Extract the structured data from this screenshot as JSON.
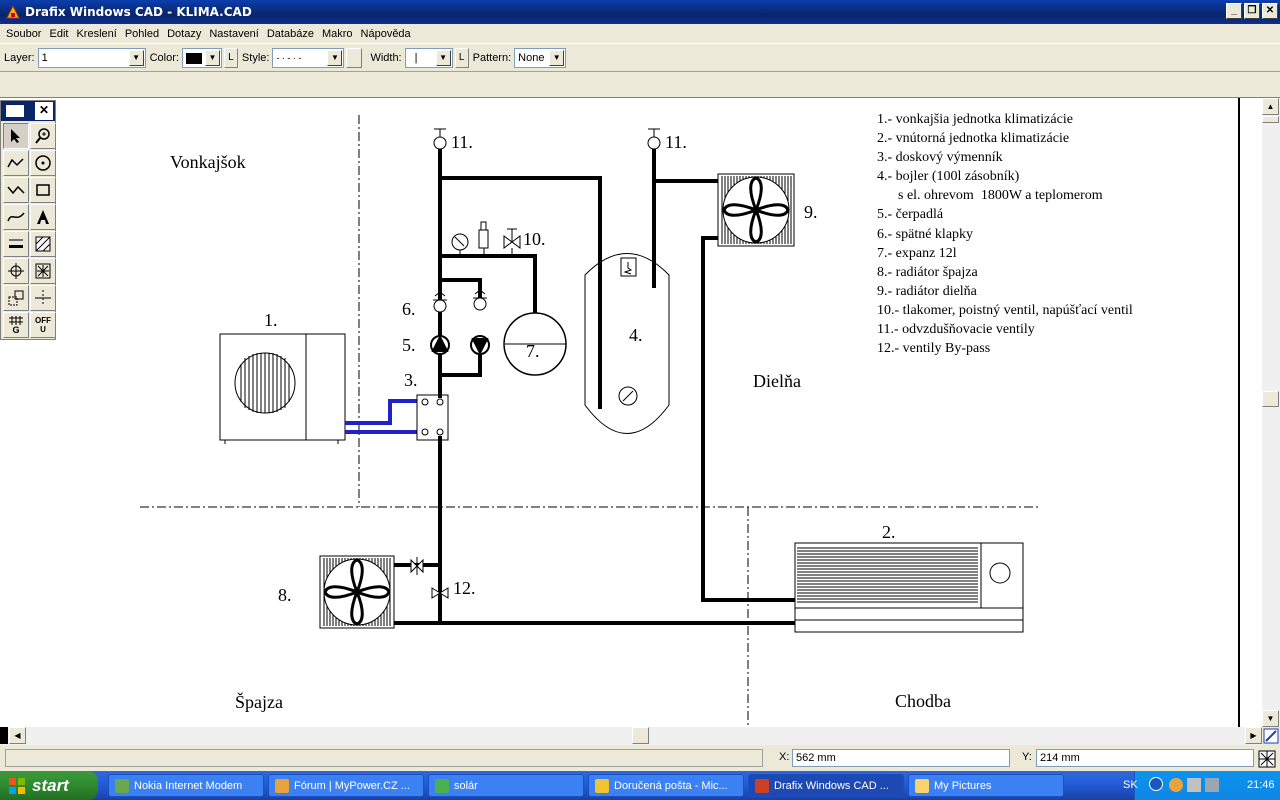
{
  "window": {
    "title": "Drafix Windows CAD - KLIMA.CAD",
    "min": "_",
    "max": "❐",
    "close": "✕"
  },
  "menu": [
    "Soubor",
    "Edit",
    "Kreslení",
    "Pohled",
    "Dotazy",
    "Nastavení",
    "Databáze",
    "Makro",
    "Nápověda"
  ],
  "toolbar": {
    "layer_label": "Layer:",
    "layer_value": "1",
    "color_label": "Color:",
    "color_value": "#000000",
    "style_label": "Style:",
    "style_value": "- · - · -",
    "width_label": "Width:",
    "width_value": "|",
    "pattern_label": "Pattern:",
    "pattern_value": "None",
    "lock_label": "L"
  },
  "palette": {
    "grid_label": "G",
    "off_label": "OFF",
    "off_sub": "U"
  },
  "drawing": {
    "rooms": {
      "outside": "Vonkajšok",
      "workshop": "Dielňa",
      "pantry": "Špajza",
      "corridor": "Chodba"
    },
    "labels": {
      "l1": "1.",
      "l2": "2.",
      "l3": "3.",
      "l4": "4.",
      "l5": "5.",
      "l6": "6.",
      "l7": "7.",
      "l8": "8.",
      "l9": "9.",
      "l10": "10.",
      "l11a": "11.",
      "l11b": "11.",
      "l12": "12."
    },
    "legend": [
      "1.- vonkajšia jednotka klimatizácie",
      "2.- vnútorná jednotka klimatizácie",
      "3.- doskový výmenník",
      "4.- bojler (100l zásobník)",
      "      s el. ohrevom  1800W a teplomerom",
      "5.- čerpadlá",
      "6.- spätné klapky",
      "7.- expanz 12l",
      "8.- radiátor špajza",
      "9.- radiátor dielňa",
      "10.- tlakomer, poistný ventil, napúšťací ventil",
      "11.- odvzdušňovacie ventily",
      "12.- ventily By-pass"
    ]
  },
  "status": {
    "x_label": "X:",
    "x_value": "562 mm",
    "y_label": "Y:",
    "y_value": "214 mm"
  },
  "taskbar": {
    "start": "start",
    "tasks": [
      {
        "label": "Nokia Internet Modem",
        "color": "#6aa84f"
      },
      {
        "label": "Fórum | MyPower.CZ ...",
        "color": "#e8a33d"
      },
      {
        "label": "solár",
        "color": "#4caf50"
      },
      {
        "label": "Doručená pošta - Mic...",
        "color": "#f1c232"
      },
      {
        "label": "Drafix Windows CAD ...",
        "color": "#cc4125"
      },
      {
        "label": "My Pictures",
        "color": "#f6d36b"
      }
    ],
    "lang": "SK",
    "time": "21:46"
  }
}
